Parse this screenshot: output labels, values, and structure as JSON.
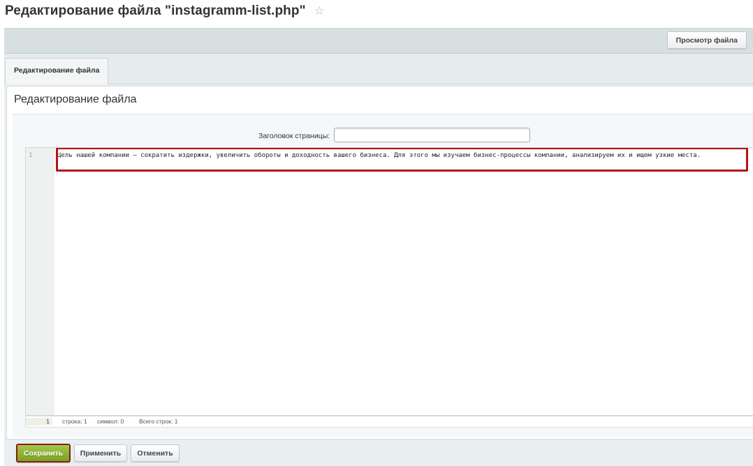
{
  "header": {
    "title": "Редактирование файла \"instagramm-list.php\"",
    "star_icon": "☆"
  },
  "toolbar": {
    "view_file_label": "Просмотр файла"
  },
  "tabs": [
    {
      "label": "Редактирование файла",
      "active": true
    }
  ],
  "main": {
    "section_title": "Редактирование файла",
    "page_title_field": {
      "label": "Заголовок страницы:",
      "value": ""
    },
    "editor": {
      "lines": [
        {
          "number": "1",
          "text": "Цель нашей компании — сократить издержки, увеличить обороты и доходность вашего бизнеса. Для этого мы изучаем бизнес-процессы компании, анализируем их и ищем узкие места."
        }
      ],
      "highlight_color": "#b2141b"
    },
    "status": {
      "current_line": "1",
      "line_text": "строка: 1",
      "char_text": "символ: 0",
      "total_text": "Всего строк: 1"
    }
  },
  "buttons": {
    "save_label": "Сохранить",
    "apply_label": "Применить",
    "cancel_label": "Отменить"
  },
  "colors": {
    "save_button": "#8db532",
    "toolbar_bg": "#d8dfe1",
    "highlight_border": "#b2141b"
  }
}
